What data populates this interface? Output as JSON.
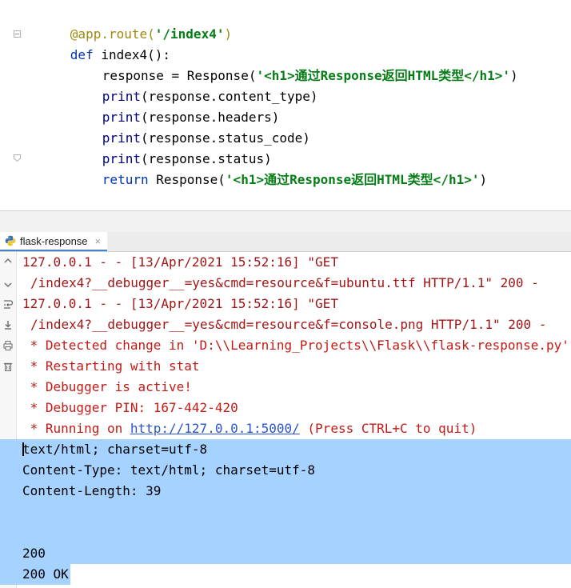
{
  "editor": {
    "lines": {
      "l1": {
        "deco": "@app.route(",
        "str": "'/index4'",
        "close": ")"
      },
      "l2": {
        "kw": "def",
        "name": " index4():"
      },
      "l3": {
        "pre": "response = Response(",
        "str": "'<h1>通过Response返回HTML类型</h1>'",
        "close": ")"
      },
      "l4": {
        "fn": "print",
        "rest": "(response.content_type)"
      },
      "l5": {
        "fn": "print",
        "rest": "(response.headers)"
      },
      "l6": {
        "fn": "print",
        "rest": "(response.status_code)"
      },
      "l7": {
        "fn": "print",
        "rest": "(response.status)"
      },
      "l8": {
        "kw": "return",
        "pre": " Response(",
        "str": "'<h1>通过Response返回HTML类型</h1>'",
        "close": ")"
      }
    }
  },
  "run_tab": {
    "label": "flask-response",
    "close": "×"
  },
  "console": {
    "log1": "127.0.0.1 - - [13/Apr/2021 15:52:16] \"GET",
    "log1b": "/index4?__debugger__=yes&cmd=resource&f=ubuntu.ttf HTTP/1.1\" 200 -",
    "log2": "127.0.0.1 - - [13/Apr/2021 15:52:16] \"GET",
    "log2b": "/index4?__debugger__=yes&cmd=resource&f=console.png HTTP/1.1\" 200 -",
    "detected": " * Detected change in 'D:\\\\Learning_Projects\\\\Flask\\\\flask-response.py'",
    "restarting": " * Restarting with stat",
    "debugger": " * Debugger is active!",
    "pin": " * Debugger PIN: 167-442-420",
    "running_pre": " * Running on ",
    "running_link": "http://127.0.0.1:5000/",
    "running_post": " (Press CTRL+C to quit)",
    "out1": "text/html; charset=utf-8",
    "out2": "Content-Type: text/html; charset=utf-8",
    "out3": "Content-Length: 39",
    "out4": "",
    "out5": "",
    "out6": "200",
    "out7": "200 OK"
  }
}
